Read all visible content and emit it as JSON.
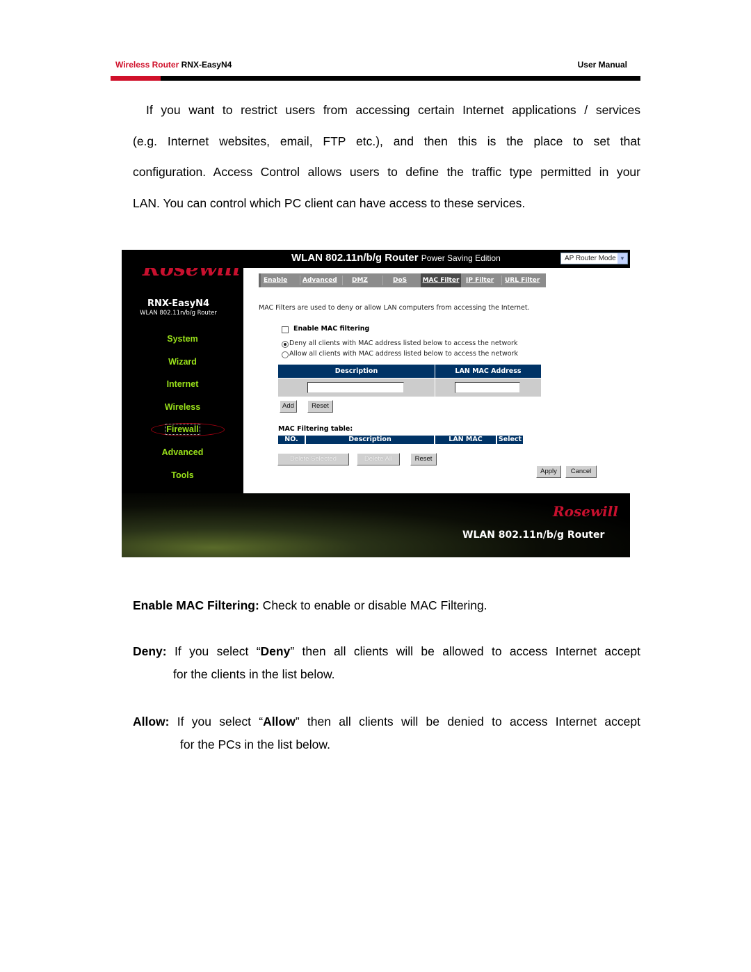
{
  "header": {
    "brand": "Wireless Router",
    "model": "RNX-EasyN4",
    "manual": "User Manual",
    "colors": {
      "brand_red": "#d0102a",
      "rule_black": "#000000"
    }
  },
  "intro_paragraph": {
    "lines": [
      "If you want to restrict users from accessing certain Internet applications / services",
      "(e.g. Internet websites, email, FTP etc.), and then this is the place to set that",
      "configuration. Access Control allows users to define the traffic type permitted in your",
      "LAN. You can control which PC client can have access to these services."
    ]
  },
  "screenshot": {
    "top_title": "WLAN 802.11n/b/g Router",
    "top_subtitle": "Power Saving Edition",
    "mode_select": {
      "value": "AP Router Mode"
    },
    "logo": "Rosewill",
    "model_name": "RNX-EasyN4",
    "model_sub": "WLAN 802.11n/b/g Router",
    "nav": [
      "System",
      "Wizard",
      "Internet",
      "Wireless",
      "Firewall",
      "Advanced",
      "Tools"
    ],
    "nav_active": "Firewall",
    "tabs": [
      "Enable",
      "Advanced",
      "DMZ",
      "DoS",
      "MAC Filter",
      "IP Filter",
      "URL Filter"
    ],
    "tab_active": "MAC Filter",
    "intro": "MAC Filters are used to deny or allow LAN computers from accessing the Internet.",
    "enable_label": "Enable MAC filtering",
    "enable_checked": false,
    "radio_deny": "Deny all clients with MAC address listed below to access the network",
    "radio_allow": "Allow all clients with MAC address listed below to access the network",
    "radio_selected": "deny",
    "add_table": {
      "headers": [
        "Description",
        "LAN MAC Address"
      ],
      "description_value": "",
      "mac_value": ""
    },
    "add_button": "Add",
    "reset_button": "Reset",
    "filter_table_title": "MAC Filtering table:",
    "filter_table_headers": [
      "NO.",
      "Description",
      "LAN MAC Address",
      "Select"
    ],
    "delete_selected": "Delete Selected",
    "delete_all": "Delete All",
    "reset2": "Reset",
    "apply": "Apply",
    "cancel": "Cancel",
    "footer_logo": "Rosewill",
    "footer_title": "WLAN 802.11n/b/g Router",
    "colors": {
      "nav_green": "#99e01a",
      "table_header": "#003366",
      "logo_red": "#c8102e"
    }
  },
  "descriptions": [
    {
      "term": "Enable MAC Filtering:",
      "text": " Check to enable or disable MAC Filtering."
    },
    {
      "term": "Deny:",
      "text_before": " If you select “",
      "bold": "Deny",
      "text_after": "” then all clients will be allowed to access Internet accept",
      "cont": "for the clients in the list below."
    },
    {
      "term": "Allow:",
      "text_before": " If you select “",
      "bold": "Allow",
      "text_after": "” then all clients will be denied to access Internet accept",
      "cont": "for the PCs in the list below."
    }
  ]
}
